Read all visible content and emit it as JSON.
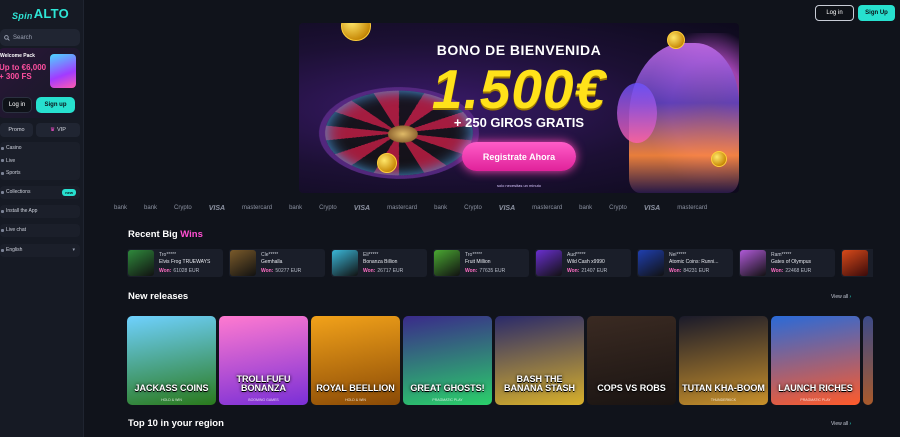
{
  "brand": {
    "spin": "Spin",
    "alto": "ALTO"
  },
  "sidebar": {
    "search_placeholder": "Search",
    "promo": {
      "title": "Welcome Pack",
      "line1": "Up to €6,000",
      "line2": "+ 300 FS"
    },
    "login": "Log in",
    "signup": "Sign up",
    "promo_btn": "Promo",
    "vip_btn": "VIP",
    "nav": [
      "Casino",
      "Live",
      "Sports"
    ],
    "collections": "Collections",
    "collections_badge": "new",
    "install": "Install the App",
    "live_chat": "Live chat",
    "language": "English"
  },
  "header": {
    "login": "Log in",
    "signup": "Sign Up"
  },
  "hero": {
    "bonus": "BONO DE BIENVENIDA",
    "amount": "1.500€",
    "spins": "+ 250 GIROS GRATIS",
    "cta": "Registrate Ahora",
    "note": "solo necesitas un minuto"
  },
  "providers": [
    "bank",
    "bank",
    "Crypto",
    "VISA",
    "mastercard",
    "bank",
    "Crypto",
    "VISA",
    "mastercard",
    "bank",
    "Crypto",
    "VISA",
    "mastercard",
    "bank",
    "Crypto",
    "VISA",
    "mastercard"
  ],
  "recent_wins": {
    "title": "Recent Big ",
    "title_accent": "Wins",
    "won_label": "Won:",
    "items": [
      {
        "user": "Tro*****",
        "game": "Elvis Frog TRUEWAYS",
        "amount": "61028 EUR",
        "color": "#2f8a3c"
      },
      {
        "user": "Cle*****",
        "game": "Gemhalla",
        "amount": "50277 EUR",
        "color": "#7a5a2a"
      },
      {
        "user": "Eli*****",
        "game": "Bonanza Billion",
        "amount": "26717 EUR",
        "color": "#3ab7d8"
      },
      {
        "user": "Tro*****",
        "game": "Fruit Million",
        "amount": "77635 EUR",
        "color": "#4aa832"
      },
      {
        "user": "Aud*****",
        "game": "Wild Cash x9990",
        "amount": "21407 EUR",
        "color": "#6a2fd0"
      },
      {
        "user": "Nei*****",
        "game": "Atomic Coins: Runni...",
        "amount": "84231 EUR",
        "color": "#1f3fb0"
      },
      {
        "user": "Ram*****",
        "game": "Gates of Olympus",
        "amount": "22468 EUR",
        "color": "#b05ad8"
      }
    ]
  },
  "new_releases": {
    "title": "New releases",
    "view_all": "View all",
    "games": [
      {
        "name": "JACKASS COINS",
        "provider": "HOLD & WIN",
        "c1": "#6fd1ff",
        "c2": "#2a7a1c"
      },
      {
        "name": "TROLLFUFU BONANZA",
        "provider": "BOOMING GAMES",
        "c1": "#ff7ad0",
        "c2": "#7a2fd6"
      },
      {
        "name": "ROYAL BEELLION",
        "provider": "HOLD & WIN",
        "c1": "#f2a21a",
        "c2": "#8a4a06"
      },
      {
        "name": "GREAT GHOSTS!",
        "provider": "PRAGMATIC PLAY",
        "c1": "#3a2a8a",
        "c2": "#2ad06a"
      },
      {
        "name": "BASH THE BANANA STASH",
        "provider": "",
        "c1": "#2a2a6a",
        "c2": "#d8b02a"
      },
      {
        "name": "COPS VS ROBS",
        "provider": "",
        "c1": "#3a2a22",
        "c2": "#1a1412"
      },
      {
        "name": "TUTAN KHA-BOOM",
        "provider": "THUNDERKICK",
        "c1": "#1a1a2a",
        "c2": "#c8902a"
      },
      {
        "name": "LAUNCH RICHES",
        "provider": "PRAGMATIC PLAY",
        "c1": "#2a6ad8",
        "c2": "#ff5a2a"
      }
    ]
  },
  "top10": {
    "title": "Top 10 in your region",
    "view_all": "View all"
  }
}
